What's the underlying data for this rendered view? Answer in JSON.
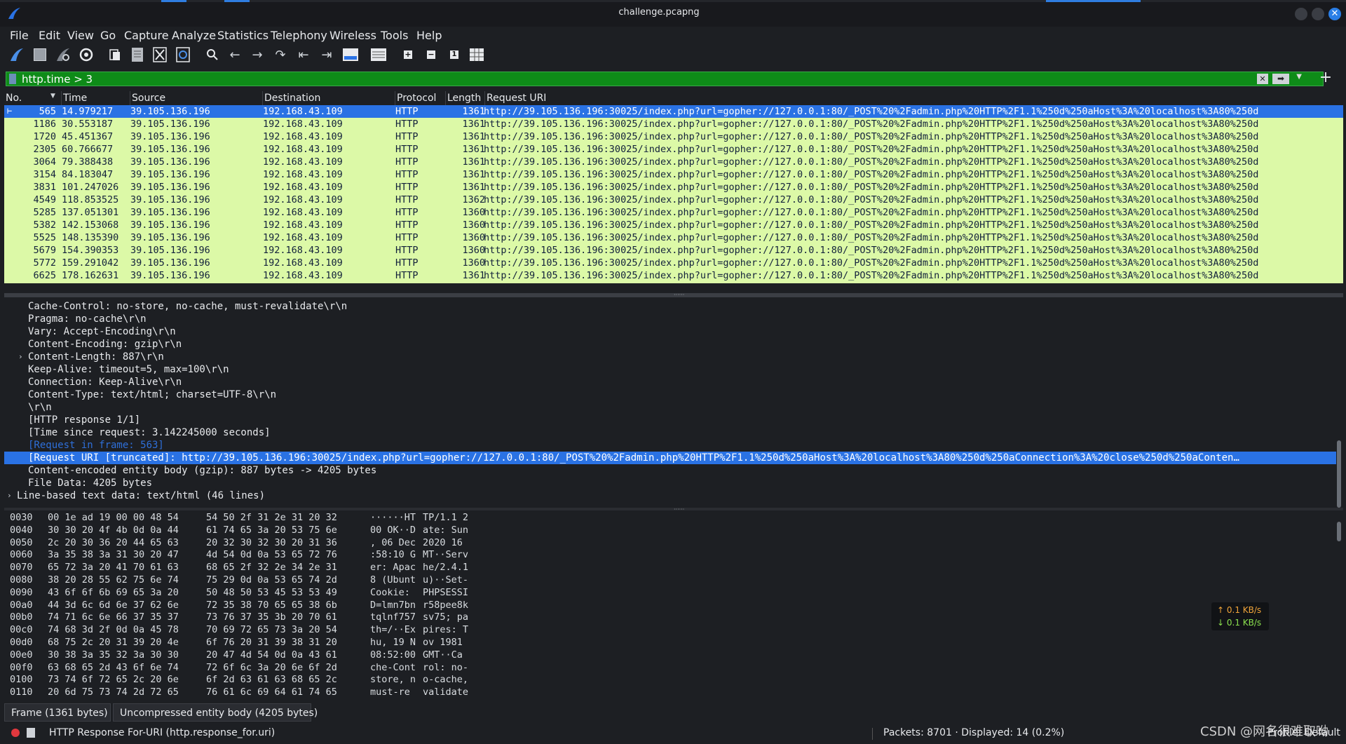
{
  "window": {
    "title": "challenge.pcapng"
  },
  "menu": [
    "File",
    "Edit",
    "View",
    "Go",
    "Capture",
    "Analyze",
    "Statistics",
    "Telephony",
    "Wireless",
    "Tools",
    "Help"
  ],
  "toolbar": {
    "icons": [
      "shark-fin-start-icon",
      "stop-capture-icon",
      "restart-capture-icon",
      "capture-options-icon",
      "open-file-icon",
      "save-file-icon",
      "close-file-icon",
      "reload-file-icon",
      "find-packet-icon",
      "go-back-icon",
      "go-forward-icon",
      "go-to-packet-icon",
      "first-packet-icon",
      "last-packet-icon",
      "autoscroll-icon",
      "colorize-icon",
      "zoom-in-icon",
      "zoom-out-icon",
      "normal-size-icon",
      "resize-columns-icon"
    ]
  },
  "filter": {
    "value": "http.time > 3"
  },
  "packet_list": {
    "columns": [
      "No.",
      "Time",
      "Source",
      "Destination",
      "Protocol",
      "Length",
      "Request URI"
    ],
    "rows": [
      {
        "no": "565",
        "time": "14.979217",
        "src": "39.105.136.196",
        "dst": "192.168.43.109",
        "proto": "HTTP",
        "len": "1361",
        "uri": "http://39.105.136.196:30025/index.php?url=gopher://127.0.0.1:80/_POST%20%2Fadmin.php%20HTTP%2F1.1%250d%250aHost%3A%20localhost%3A80%250d"
      },
      {
        "no": "1186",
        "time": "30.553187",
        "src": "39.105.136.196",
        "dst": "192.168.43.109",
        "proto": "HTTP",
        "len": "1361",
        "uri": "http://39.105.136.196:30025/index.php?url=gopher://127.0.0.1:80/_POST%20%2Fadmin.php%20HTTP%2F1.1%250d%250aHost%3A%20localhost%3A80%250d"
      },
      {
        "no": "1720",
        "time": "45.451367",
        "src": "39.105.136.196",
        "dst": "192.168.43.109",
        "proto": "HTTP",
        "len": "1361",
        "uri": "http://39.105.136.196:30025/index.php?url=gopher://127.0.0.1:80/_POST%20%2Fadmin.php%20HTTP%2F1.1%250d%250aHost%3A%20localhost%3A80%250d"
      },
      {
        "no": "2305",
        "time": "60.766677",
        "src": "39.105.136.196",
        "dst": "192.168.43.109",
        "proto": "HTTP",
        "len": "1361",
        "uri": "http://39.105.136.196:30025/index.php?url=gopher://127.0.0.1:80/_POST%20%2Fadmin.php%20HTTP%2F1.1%250d%250aHost%3A%20localhost%3A80%250d"
      },
      {
        "no": "3064",
        "time": "79.388438",
        "src": "39.105.136.196",
        "dst": "192.168.43.109",
        "proto": "HTTP",
        "len": "1361",
        "uri": "http://39.105.136.196:30025/index.php?url=gopher://127.0.0.1:80/_POST%20%2Fadmin.php%20HTTP%2F1.1%250d%250aHost%3A%20localhost%3A80%250d"
      },
      {
        "no": "3154",
        "time": "84.183047",
        "src": "39.105.136.196",
        "dst": "192.168.43.109",
        "proto": "HTTP",
        "len": "1361",
        "uri": "http://39.105.136.196:30025/index.php?url=gopher://127.0.0.1:80/_POST%20%2Fadmin.php%20HTTP%2F1.1%250d%250aHost%3A%20localhost%3A80%250d"
      },
      {
        "no": "3831",
        "time": "101.247026",
        "src": "39.105.136.196",
        "dst": "192.168.43.109",
        "proto": "HTTP",
        "len": "1361",
        "uri": "http://39.105.136.196:30025/index.php?url=gopher://127.0.0.1:80/_POST%20%2Fadmin.php%20HTTP%2F1.1%250d%250aHost%3A%20localhost%3A80%250d"
      },
      {
        "no": "4549",
        "time": "118.853525",
        "src": "39.105.136.196",
        "dst": "192.168.43.109",
        "proto": "HTTP",
        "len": "1362",
        "uri": "http://39.105.136.196:30025/index.php?url=gopher://127.0.0.1:80/_POST%20%2Fadmin.php%20HTTP%2F1.1%250d%250aHost%3A%20localhost%3A80%250d"
      },
      {
        "no": "5285",
        "time": "137.051301",
        "src": "39.105.136.196",
        "dst": "192.168.43.109",
        "proto": "HTTP",
        "len": "1360",
        "uri": "http://39.105.136.196:30025/index.php?url=gopher://127.0.0.1:80/_POST%20%2Fadmin.php%20HTTP%2F1.1%250d%250aHost%3A%20localhost%3A80%250d"
      },
      {
        "no": "5382",
        "time": "142.153068",
        "src": "39.105.136.196",
        "dst": "192.168.43.109",
        "proto": "HTTP",
        "len": "1360",
        "uri": "http://39.105.136.196:30025/index.php?url=gopher://127.0.0.1:80/_POST%20%2Fadmin.php%20HTTP%2F1.1%250d%250aHost%3A%20localhost%3A80%250d"
      },
      {
        "no": "5525",
        "time": "148.135390",
        "src": "39.105.136.196",
        "dst": "192.168.43.109",
        "proto": "HTTP",
        "len": "1360",
        "uri": "http://39.105.136.196:30025/index.php?url=gopher://127.0.0.1:80/_POST%20%2Fadmin.php%20HTTP%2F1.1%250d%250aHost%3A%20localhost%3A80%250d"
      },
      {
        "no": "5679",
        "time": "154.390353",
        "src": "39.105.136.196",
        "dst": "192.168.43.109",
        "proto": "HTTP",
        "len": "1360",
        "uri": "http://39.105.136.196:30025/index.php?url=gopher://127.0.0.1:80/_POST%20%2Fadmin.php%20HTTP%2F1.1%250d%250aHost%3A%20localhost%3A80%250d"
      },
      {
        "no": "5772",
        "time": "159.291042",
        "src": "39.105.136.196",
        "dst": "192.168.43.109",
        "proto": "HTTP",
        "len": "1360",
        "uri": "http://39.105.136.196:30025/index.php?url=gopher://127.0.0.1:80/_POST%20%2Fadmin.php%20HTTP%2F1.1%250d%250aHost%3A%20localhost%3A80%250d"
      },
      {
        "no": "6625",
        "time": "178.162631",
        "src": "39.105.136.196",
        "dst": "192.168.43.109",
        "proto": "HTTP",
        "len": "1361",
        "uri": "http://39.105.136.196:30025/index.php?url=gopher://127.0.0.1:80/_POST%20%2Fadmin.php%20HTTP%2F1.1%250d%250aHost%3A%20localhost%3A80%250d"
      }
    ],
    "selected_index": 0
  },
  "details": [
    {
      "text": "Cache-Control: no-store, no-cache, must-revalidate\\r\\n",
      "indent": 2,
      "style": "normal",
      "expander": false
    },
    {
      "text": "Pragma: no-cache\\r\\n",
      "indent": 2,
      "style": "normal",
      "expander": false
    },
    {
      "text": "Vary: Accept-Encoding\\r\\n",
      "indent": 2,
      "style": "normal",
      "expander": false
    },
    {
      "text": "Content-Encoding: gzip\\r\\n",
      "indent": 2,
      "style": "normal",
      "expander": false
    },
    {
      "text": "Content-Length: 887\\r\\n",
      "indent": 2,
      "style": "normal",
      "expander": true
    },
    {
      "text": "Keep-Alive: timeout=5, max=100\\r\\n",
      "indent": 2,
      "style": "normal",
      "expander": false
    },
    {
      "text": "Connection: Keep-Alive\\r\\n",
      "indent": 2,
      "style": "normal",
      "expander": false
    },
    {
      "text": "Content-Type: text/html; charset=UTF-8\\r\\n",
      "indent": 2,
      "style": "normal",
      "expander": false
    },
    {
      "text": "\\r\\n",
      "indent": 2,
      "style": "normal",
      "expander": false
    },
    {
      "text": "[HTTP response 1/1]",
      "indent": 2,
      "style": "normal",
      "expander": false
    },
    {
      "text": "[Time since request: 3.142245000 seconds]",
      "indent": 2,
      "style": "normal",
      "expander": false
    },
    {
      "text": "[Request in frame: 563]",
      "indent": 2,
      "style": "link",
      "expander": false
    },
    {
      "text": "[Request URI [truncated]: http://39.105.136.196:30025/index.php?url=gopher://127.0.0.1:80/_POST%20%2Fadmin.php%20HTTP%2F1.1%250d%250aHost%3A%20localhost%3A80%250d%250aConnection%3A%20close%250d%250aConten…",
      "indent": 2,
      "style": "selected",
      "expander": false
    },
    {
      "text": "Content-encoded entity body (gzip): 887 bytes -> 4205 bytes",
      "indent": 2,
      "style": "normal",
      "expander": false
    },
    {
      "text": "File Data: 4205 bytes",
      "indent": 2,
      "style": "normal",
      "expander": false
    },
    {
      "text": "Line-based text data: text/html (46 lines)",
      "indent": 1,
      "style": "normal",
      "expander": true
    }
  ],
  "hex": [
    {
      "off": "0030",
      "b1": "00 1e ad 19 00 00 48 54",
      "b2": "54 50 2f 31 2e 31 20 32",
      "a1": "······HT",
      "a2": "TP/1.1 2"
    },
    {
      "off": "0040",
      "b1": "30 30 20 4f 4b 0d 0a 44",
      "b2": "61 74 65 3a 20 53 75 6e",
      "a1": "00 OK··D",
      "a2": "ate: Sun"
    },
    {
      "off": "0050",
      "b1": "2c 20 30 36 20 44 65 63",
      "b2": "20 32 30 32 30 20 31 36",
      "a1": ", 06 Dec",
      "a2": " 2020 16"
    },
    {
      "off": "0060",
      "b1": "3a 35 38 3a 31 30 20 47",
      "b2": "4d 54 0d 0a 53 65 72 76",
      "a1": ":58:10 G",
      "a2": "MT··Serv"
    },
    {
      "off": "0070",
      "b1": "65 72 3a 20 41 70 61 63",
      "b2": "68 65 2f 32 2e 34 2e 31",
      "a1": "er: Apac",
      "a2": "he/2.4.1"
    },
    {
      "off": "0080",
      "b1": "38 20 28 55 62 75 6e 74",
      "b2": "75 29 0d 0a 53 65 74 2d",
      "a1": "8 (Ubunt",
      "a2": "u)··Set-"
    },
    {
      "off": "0090",
      "b1": "43 6f 6f 6b 69 65 3a 20",
      "b2": "50 48 50 53 45 53 53 49",
      "a1": "Cookie: ",
      "a2": "PHPSESSI"
    },
    {
      "off": "00a0",
      "b1": "44 3d 6c 6d 6e 37 62 6e",
      "b2": "72 35 38 70 65 65 38 6b",
      "a1": "D=lmn7bn",
      "a2": "r58pee8k"
    },
    {
      "off": "00b0",
      "b1": "74 71 6c 6e 66 37 35 37",
      "b2": "73 76 37 35 3b 20 70 61",
      "a1": "tqlnf757",
      "a2": "sv75; pa"
    },
    {
      "off": "00c0",
      "b1": "74 68 3d 2f 0d 0a 45 78",
      "b2": "70 69 72 65 73 3a 20 54",
      "a1": "th=/··Ex",
      "a2": "pires: T"
    },
    {
      "off": "00d0",
      "b1": "68 75 2c 20 31 39 20 4e",
      "b2": "6f 76 20 31 39 38 31 20",
      "a1": "hu, 19 N",
      "a2": "ov 1981 "
    },
    {
      "off": "00e0",
      "b1": "30 38 3a 35 32 3a 30 30",
      "b2": "20 47 4d 54 0d 0a 43 61",
      "a1": "08:52:00",
      "a2": " GMT··Ca"
    },
    {
      "off": "00f0",
      "b1": "63 68 65 2d 43 6f 6e 74",
      "b2": "72 6f 6c 3a 20 6e 6f 2d",
      "a1": "che-Cont",
      "a2": "rol: no-"
    },
    {
      "off": "0100",
      "b1": "73 74 6f 72 65 2c 20 6e",
      "b2": "6f 2d 63 61 63 68 65 2c",
      "a1": "store, n",
      "a2": "o-cache,"
    },
    {
      "off": "0110",
      "b1": "20 6d 75 73 74 2d 72 65",
      "b2": "76 61 6c 69 64 61 74 65",
      "a1": " must-re",
      "a2": "validate"
    }
  ],
  "netspeed": {
    "up": "↑ 0.1 KB/s",
    "down": "↓ 0.1 KB/s"
  },
  "bytes_tabs": [
    "Frame (1361 bytes)",
    "Uncompressed entity body (4205 bytes)"
  ],
  "status": {
    "field": "HTTP Response For-URI (http.response_for.uri)",
    "packets": "Packets: 8701 · Displayed: 14 (0.2%)",
    "profile": "Profile: Default"
  },
  "watermark": "CSDN @网名很难取呦",
  "colors": {
    "row_bg": "#dcf9a7",
    "selected": "#2a72e4",
    "filter_bg": "#0e8b18",
    "link": "#2e6fd9"
  }
}
